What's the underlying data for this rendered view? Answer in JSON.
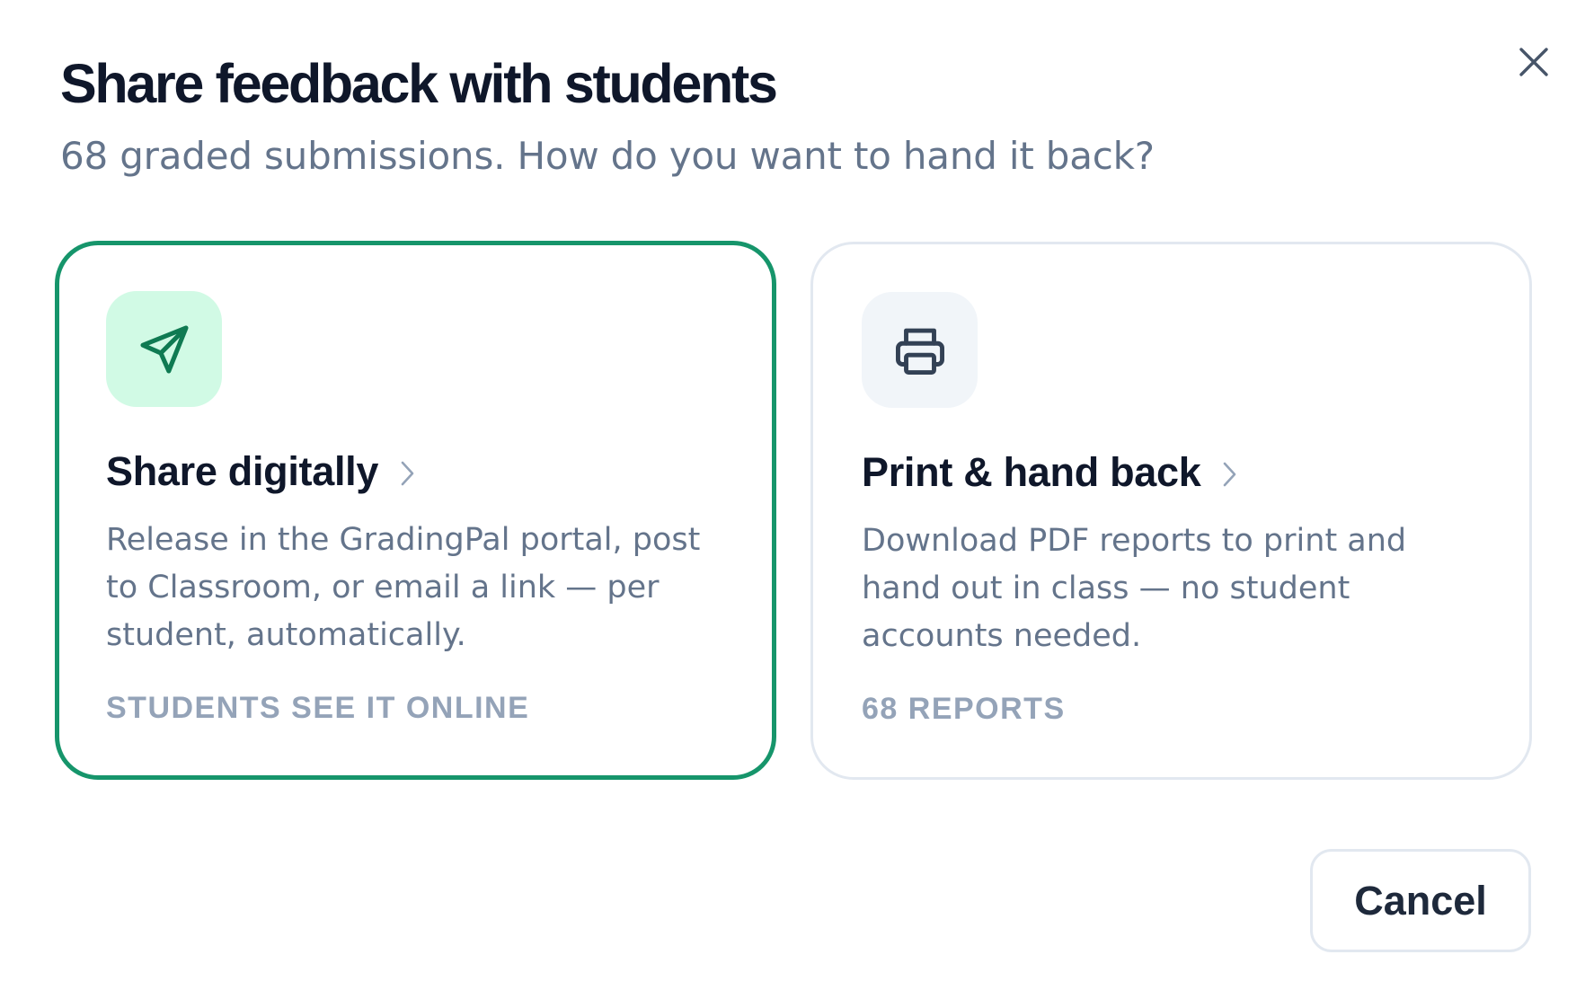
{
  "dialog": {
    "title": "Share feedback with students",
    "subtitle": "68 graded submissions. How do you want to hand it back?",
    "close_icon": "close-icon",
    "cancel_label": "Cancel"
  },
  "options": [
    {
      "title": "Share digitally",
      "description": "Release in the GradingPal portal, post to Classroom, or email a link — per student, automatically.",
      "meta": "STUDENTS SEE IT ONLINE",
      "icon": "send-icon",
      "selected": true,
      "accent_color": "#16956b",
      "icon_bg": "#d1fae5"
    },
    {
      "title": "Print & hand back",
      "description": "Download PDF reports to print and hand out in class — no student accounts needed.",
      "meta": "68 REPORTS",
      "icon": "printer-icon",
      "selected": false,
      "icon_bg": "#f1f5f9"
    }
  ],
  "colors": {
    "title": "#0f172a",
    "muted_text": "#64748b",
    "meta_text": "#94a3b8",
    "border": "#e2e8f0"
  }
}
